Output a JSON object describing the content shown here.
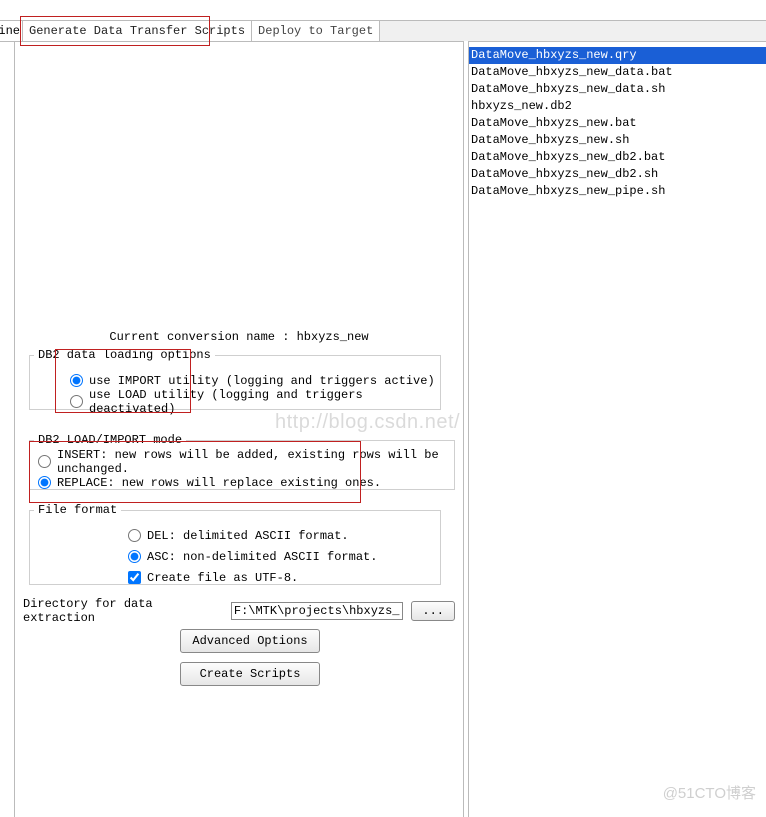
{
  "tabs": {
    "truncated_left": "ine",
    "items": [
      {
        "label": "Generate Data Transfer Scripts",
        "active": true
      },
      {
        "label": "Deploy to Target",
        "active": false
      }
    ]
  },
  "conversion": {
    "line": "Current conversion name : hbxyzs_new"
  },
  "db2_loading": {
    "legend": "DB2 data loading options",
    "opt_import": "use IMPORT utility (logging and triggers active)",
    "opt_load": "use LOAD utility   (logging and triggers deactivated)",
    "selected": "import"
  },
  "mode": {
    "legend": "DB2 LOAD/IMPORT mode",
    "opt_insert": "INSERT: new rows will be added, existing rows will be unchanged.",
    "opt_replace": "REPLACE: new rows will replace existing ones.",
    "selected": "replace"
  },
  "format": {
    "legend": "File format",
    "opt_del": "DEL: delimited ASCII format.",
    "opt_asc": "ASC: non-delimited ASCII format.",
    "utf8": "Create file as UTF-8.",
    "selected": "asc",
    "utf8_checked": true
  },
  "directory": {
    "label": "Directory for data extraction",
    "value": "F:\\MTK\\projects\\hbxyzs_new\\Dat",
    "browse": "..."
  },
  "buttons": {
    "advanced": "Advanced Options",
    "create": "Create Scripts"
  },
  "file_list": {
    "items": [
      "DataMove_hbxyzs_new.qry",
      "DataMove_hbxyzs_new_data.bat",
      "DataMove_hbxyzs_new_data.sh",
      "hbxyzs_new.db2",
      "DataMove_hbxyzs_new.bat",
      "DataMove_hbxyzs_new.sh",
      "DataMove_hbxyzs_new_db2.bat",
      "DataMove_hbxyzs_new_db2.sh",
      "DataMove_hbxyzs_new_pipe.sh"
    ],
    "selected_index": 0
  },
  "watermarks": {
    "big": "http://blog.csdn.net/",
    "corner": "@51CTO博客"
  }
}
